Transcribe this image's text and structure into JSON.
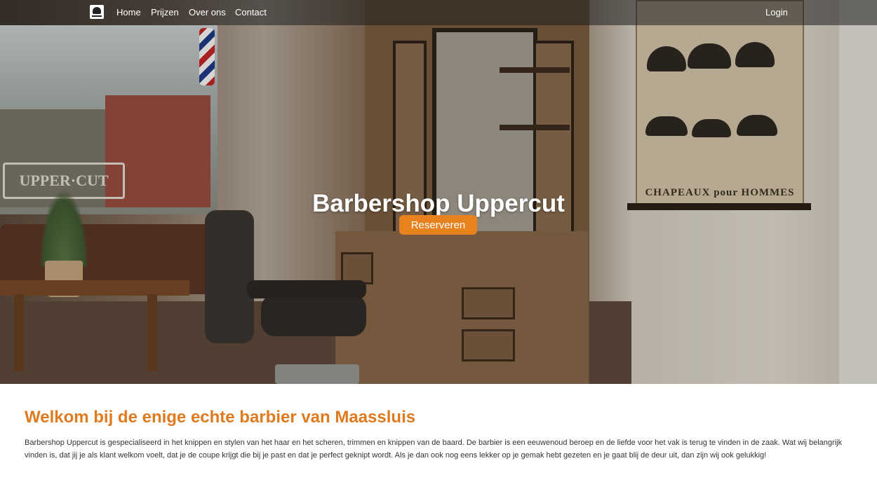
{
  "nav": {
    "items": [
      {
        "label": "Home"
      },
      {
        "label": "Prijzen"
      },
      {
        "label": "Over ons"
      },
      {
        "label": "Contact"
      }
    ],
    "login_label": "Login"
  },
  "hero": {
    "title": "Barbershop Uppercut",
    "button_label": "Reserveren",
    "window_sign": "UPPER·CUT",
    "poster_caption": "CHAPEAUX pour HOMMES"
  },
  "intro": {
    "heading": "Welkom bij de enige echte barbier van Maassluis",
    "body": "Barbershop Uppercut is gespecialiseerd in het knippen en stylen van het haar en het scheren, trimmen en knippen van de baard. De barbier is een eeuwenoud beroep en de liefde voor het vak is terug te vinden in de zaak. Wat wij belangrijk vinden is, dat jij je als klant welkom voelt, dat je de coupe krijgt die bij je past en dat je perfect geknipt wordt. Als je dan ook nog eens lekker op je gemak hebt gezeten en je gaat blij de deur uit, dan zijn wij ook gelukkig!"
  },
  "colors": {
    "accent": "#e8821e",
    "heading": "#e07a1f",
    "nav_bg": "rgba(30,30,30,0.55)"
  }
}
